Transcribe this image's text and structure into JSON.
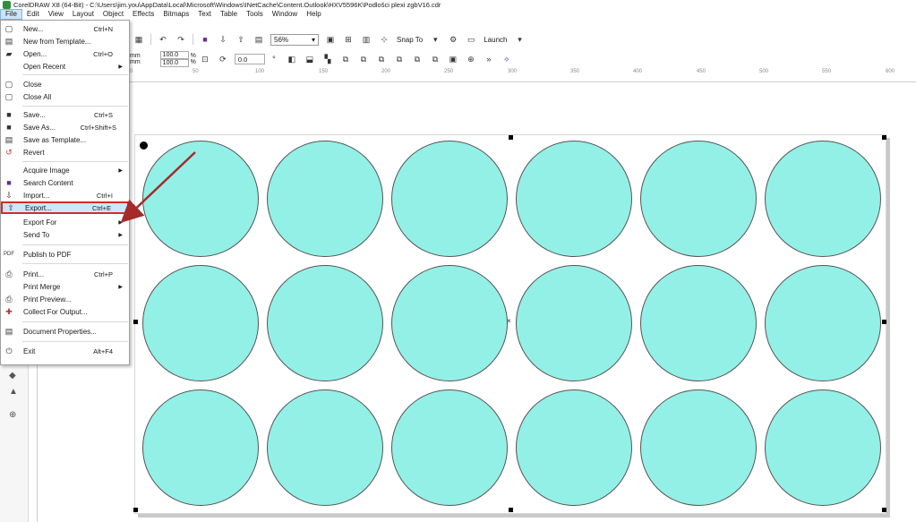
{
  "window": {
    "title": "CorelDRAW X8 (64-Bit) - C:\\Users\\jim.you\\AppData\\Local\\Microsoft\\Windows\\INetCache\\Content.Outlook\\HXV5596K\\Podlošci plexi zgbV16.cdr"
  },
  "menubar": [
    "File",
    "Edit",
    "View",
    "Layout",
    "Object",
    "Effects",
    "Bitmaps",
    "Text",
    "Table",
    "Tools",
    "Window",
    "Help"
  ],
  "toolbar": {
    "zoom": "56%",
    "snap_to": "Snap To",
    "launch": "Launch",
    "unit_a": "mm",
    "unit_b": "mm",
    "scale_x": "100.0",
    "scale_y": "100.0",
    "percent": "%",
    "rotation": "0.0"
  },
  "ruler": {
    "labels": [
      "0",
      "50",
      "100",
      "150",
      "200",
      "250",
      "300",
      "350",
      "400",
      "450",
      "500",
      "550",
      "600"
    ]
  },
  "file_menu": {
    "items": [
      {
        "label": "New...",
        "shortcut": "Ctrl+N",
        "icon": "new-doc-icon"
      },
      {
        "label": "New from Template...",
        "shortcut": "",
        "icon": "template-icon"
      },
      {
        "label": "Open...",
        "shortcut": "Ctrl+O",
        "icon": "open-folder-icon"
      },
      {
        "label": "Open Recent",
        "shortcut": "",
        "icon": "",
        "submenu": true
      },
      {
        "label": "Close",
        "shortcut": "",
        "icon": "close-doc-icon"
      },
      {
        "label": "Close All",
        "shortcut": "",
        "icon": "close-all-icon"
      },
      {
        "label": "Save...",
        "shortcut": "Ctrl+S",
        "icon": "save-icon"
      },
      {
        "label": "Save As...",
        "shortcut": "Ctrl+Shift+S",
        "icon": "save-as-icon"
      },
      {
        "label": "Save as Template...",
        "shortcut": "",
        "icon": "save-template-icon"
      },
      {
        "label": "Revert",
        "shortcut": "",
        "icon": "revert-icon"
      },
      {
        "label": "Acquire Image",
        "shortcut": "",
        "icon": "",
        "submenu": true
      },
      {
        "label": "Search Content",
        "shortcut": "",
        "icon": "search-content-icon"
      },
      {
        "label": "Import...",
        "shortcut": "Ctrl+I",
        "icon": "import-icon"
      },
      {
        "label": "Export...",
        "shortcut": "Ctrl+E",
        "icon": "export-icon"
      },
      {
        "label": "Export For",
        "shortcut": "",
        "icon": "",
        "submenu": true
      },
      {
        "label": "Send To",
        "shortcut": "",
        "icon": "",
        "submenu": true
      },
      {
        "label": "Publish to PDF",
        "shortcut": "",
        "icon": "pdf-icon"
      },
      {
        "label": "Print...",
        "shortcut": "Ctrl+P",
        "icon": "print-icon"
      },
      {
        "label": "Print Merge",
        "shortcut": "",
        "icon": "",
        "submenu": true
      },
      {
        "label": "Print Preview...",
        "shortcut": "",
        "icon": "print-preview-icon"
      },
      {
        "label": "Collect For Output...",
        "shortcut": "",
        "icon": "collect-icon"
      },
      {
        "label": "Document Properties...",
        "shortcut": "",
        "icon": "properties-icon"
      },
      {
        "label": "Exit",
        "shortcut": "Alt+F4",
        "icon": "power-icon"
      }
    ]
  },
  "colors": {
    "circle_fill": "#93f0e6",
    "highlight_border": "#d62b2b",
    "arrow": "#a52a2a"
  }
}
